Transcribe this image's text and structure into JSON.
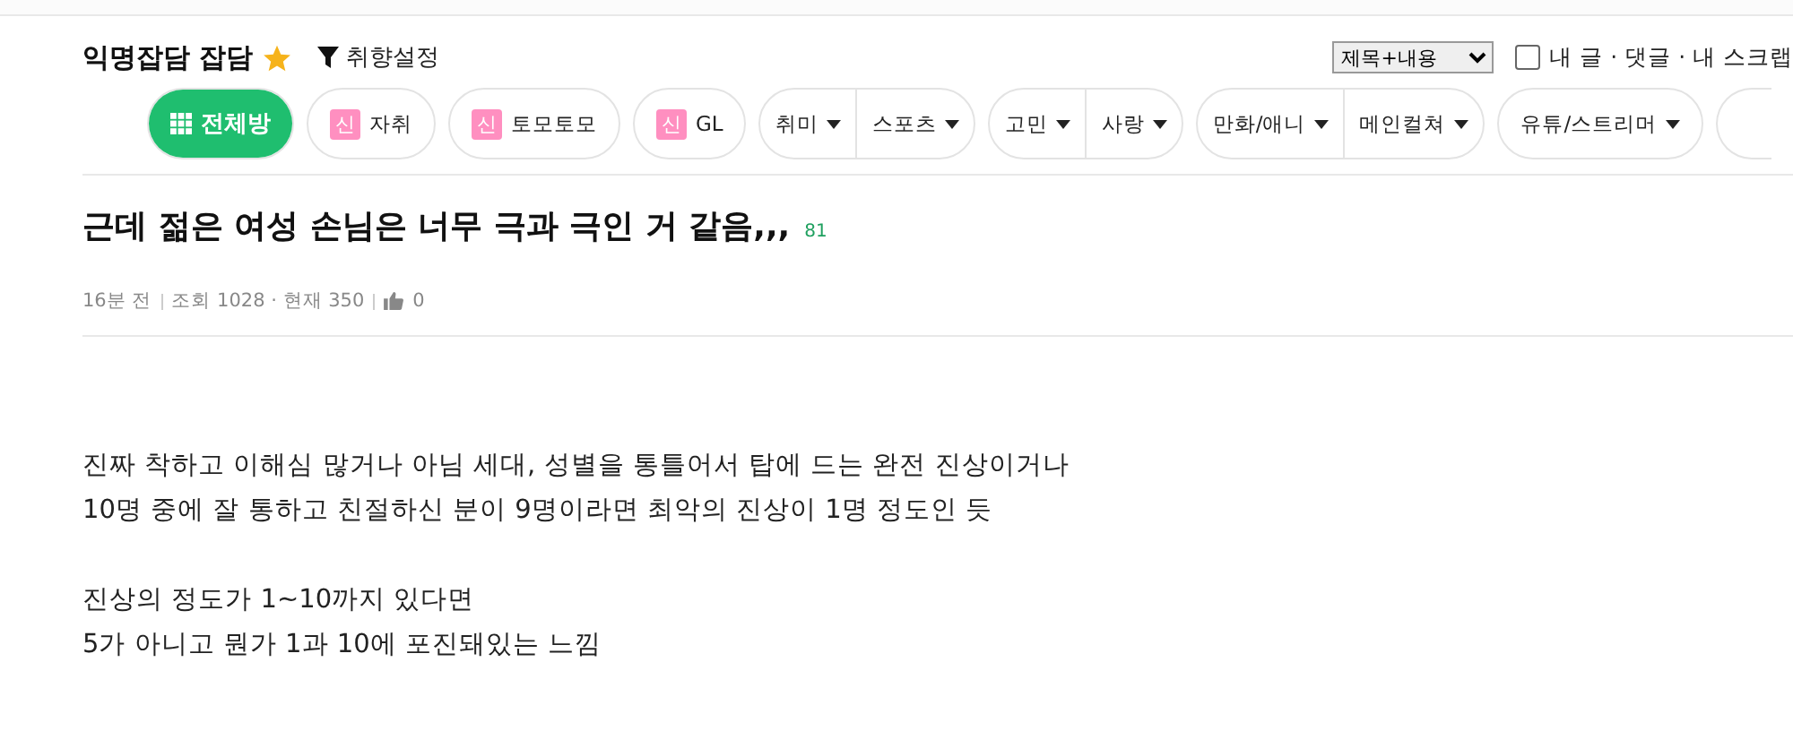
{
  "board": {
    "title": "익명잡담 잡담",
    "favorite": true,
    "filter_label": "취향설정"
  },
  "search": {
    "scope": "제목+내용",
    "mine_checked": false,
    "mine_label": "내 글 · 댓글 · 내 스크랩"
  },
  "nav_groups": [
    {
      "items": [
        {
          "kind": "all",
          "label": "전체방",
          "selected": true
        }
      ]
    },
    {
      "items": [
        {
          "kind": "new",
          "badge": "신",
          "label": "자취",
          "selected": false
        }
      ]
    },
    {
      "items": [
        {
          "kind": "new",
          "badge": "신",
          "label": "토모토모",
          "selected": false
        }
      ]
    },
    {
      "items": [
        {
          "kind": "new",
          "badge": "신",
          "label": "GL",
          "selected": false
        }
      ]
    },
    {
      "items": [
        {
          "kind": "dropdown",
          "label": "취미",
          "selected": false
        },
        {
          "kind": "dropdown",
          "label": "스포츠",
          "selected": false
        }
      ]
    },
    {
      "items": [
        {
          "kind": "dropdown",
          "label": "고민",
          "selected": false
        },
        {
          "kind": "dropdown",
          "label": "사랑",
          "selected": false
        }
      ]
    },
    {
      "items": [
        {
          "kind": "dropdown",
          "label": "만화/애니",
          "selected": false
        },
        {
          "kind": "dropdown",
          "label": "메인컬쳐",
          "selected": false
        }
      ]
    },
    {
      "items": [
        {
          "kind": "dropdown",
          "label": "유튜/스트리머",
          "selected": false
        }
      ]
    }
  ],
  "post": {
    "title": "근데 젊은 여성 손님은 너무 극과 극인 거 같음,,,",
    "comment_count": "81",
    "time": "16분 전",
    "views": "조회 1028 · 현재 350",
    "likes": "0",
    "body": [
      [
        "진짜 착하고 이해심 많거나 아님 세대, 성별을 통틀어서 탑에 드는 완전 진상이거나",
        "10명 중에 잘 통하고 친절하신 분이 9명이라면 최악의 진상이 1명 정도인 듯"
      ],
      [
        "진상의 정도가 1~10까지 있다면",
        "5가 아니고 뭔가 1과 10에 포진돼있는 느낌"
      ]
    ]
  }
}
